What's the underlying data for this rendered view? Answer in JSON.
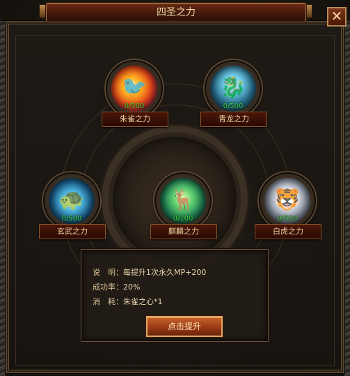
{
  "window": {
    "title": "四圣之力",
    "close_label": "✕"
  },
  "orbs": [
    {
      "id": "zhuque",
      "label": "朱雀之力",
      "count": "0/500",
      "icon": "vermilion-bird-icon",
      "glyph": "🐦"
    },
    {
      "id": "qinglong",
      "label": "青龙之力",
      "count": "0/500",
      "icon": "azure-dragon-icon",
      "glyph": "🐉"
    },
    {
      "id": "xuanwu",
      "label": "玄武之力",
      "count": "0/500",
      "icon": "black-tortoise-icon",
      "glyph": "🐢"
    },
    {
      "id": "qilin",
      "label": "麒麟之力",
      "count": "0/100",
      "icon": "qilin-icon",
      "glyph": "🦌"
    },
    {
      "id": "baihu",
      "label": "白虎之力",
      "count": "0/500",
      "icon": "white-tiger-icon",
      "glyph": "🐯"
    }
  ],
  "info": {
    "desc_key": "说　明：",
    "desc_value": "每提升1次永久MP+200",
    "rate_key": "成功率：",
    "rate_value": "20%",
    "cost_key": "消　耗：",
    "cost_value": "朱雀之心*1"
  },
  "upgrade_button": "点击提升",
  "colors": {
    "count": "#38d13a",
    "title_text": "#f2d9a6",
    "button": "#b04a1c"
  }
}
